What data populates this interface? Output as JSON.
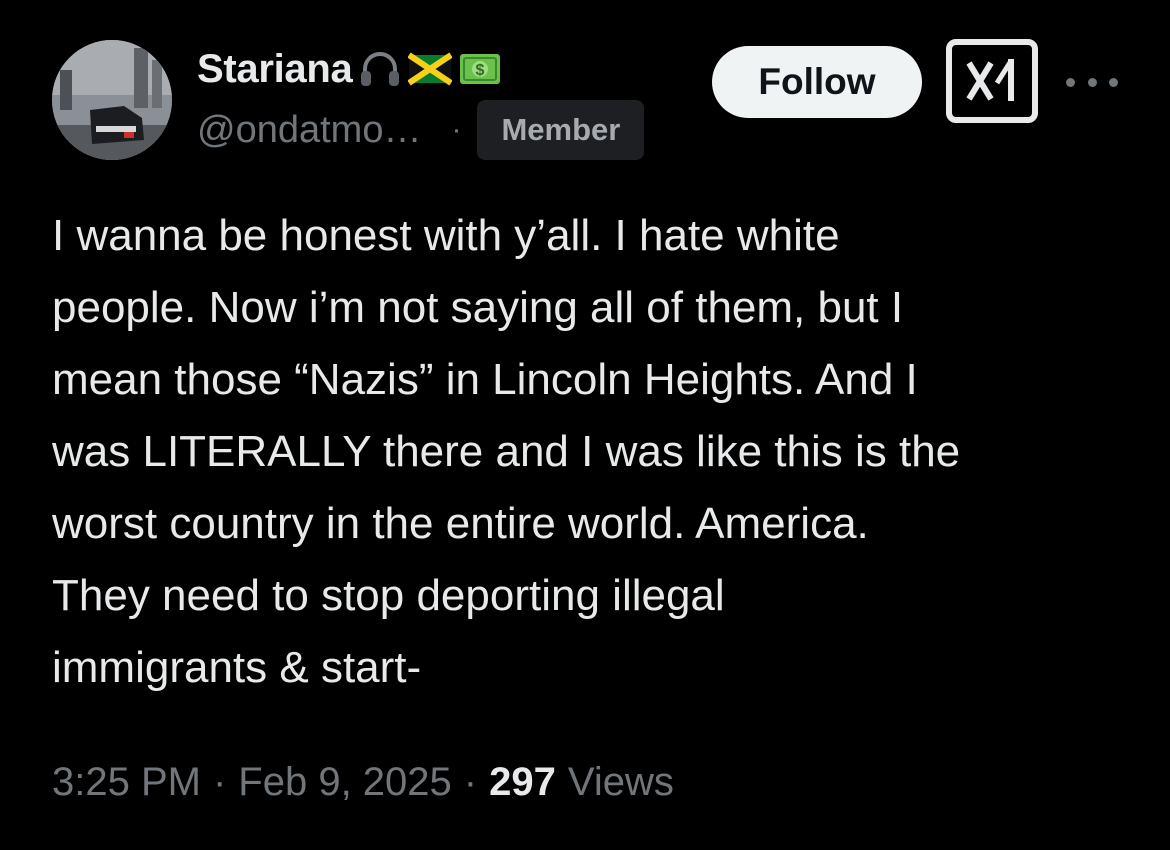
{
  "author": {
    "display_name": "Stariana",
    "name_emojis": [
      "headphones-emoji",
      "jamaica-flag-emoji",
      "dollar-banknote-emoji"
    ],
    "handle": "@ondatmo…",
    "badge": "Member",
    "avatar": "avatar-photo"
  },
  "actions": {
    "follow_label": "Follow",
    "grok_icon": "grok-icon",
    "more_icon": "more-options-icon"
  },
  "tweet": {
    "text_lines": [
      "I wanna be honest with y’all. I hate white",
      "people. Now i’m not saying all of them, but I",
      "mean those “Nazis” in Lincoln Heights. And I",
      "was LITERALLY there and I was like this is the",
      "worst country in the entire world. America.",
      "They need to stop deporting illegal",
      "immigrants & start-"
    ]
  },
  "meta": {
    "time": "3:25 PM",
    "date": "Feb 9, 2025",
    "separator": "·",
    "views_count": "297",
    "views_label": "Views"
  },
  "colors": {
    "background": "#000000",
    "primary_text": "#e7e9ea",
    "secondary_text": "#71767b",
    "follow_button_bg": "#eff3f4",
    "follow_button_text": "#0f1419",
    "badge_bg": "#1d1f23"
  }
}
